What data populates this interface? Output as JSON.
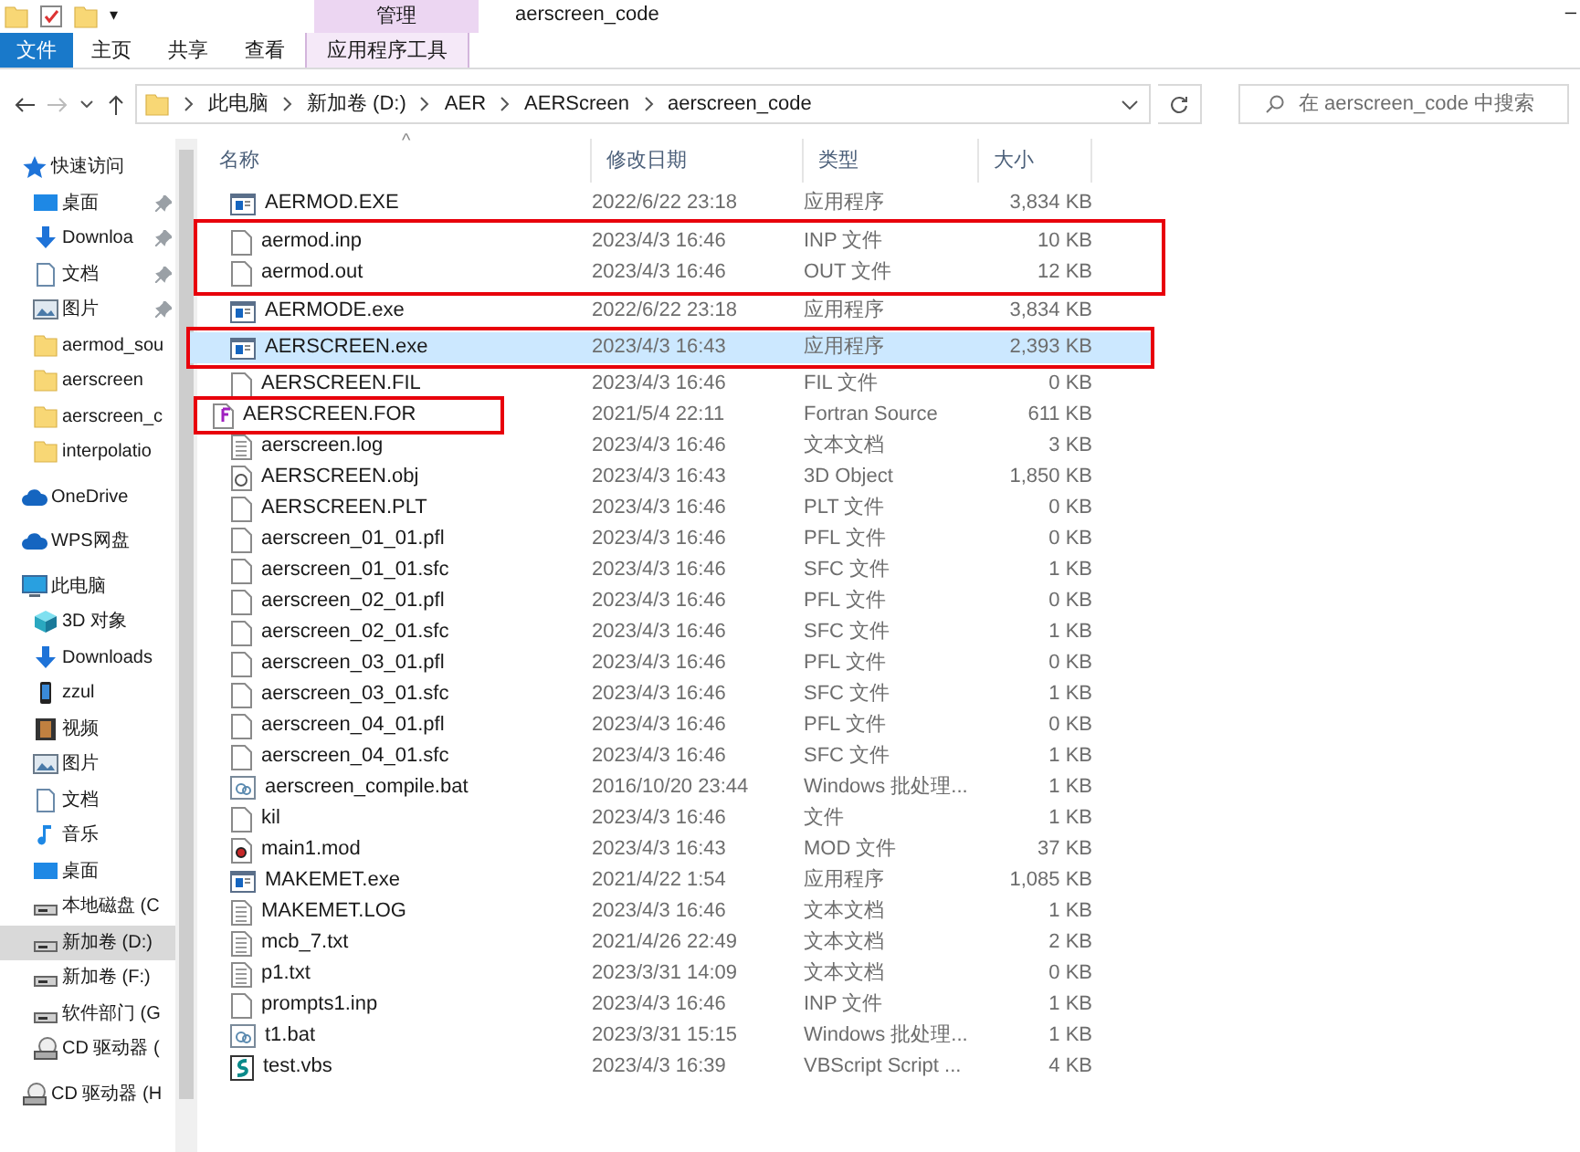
{
  "title_bar": {
    "context_tab": "管理",
    "title": "aerscreen_code",
    "quick_access_caret": "▾",
    "minimize": "–"
  },
  "ribbon_tabs": [
    {
      "label": "文件",
      "kind": "file"
    },
    {
      "label": "主页",
      "kind": "tab"
    },
    {
      "label": "共享",
      "kind": "tab"
    },
    {
      "label": "查看",
      "kind": "tab"
    },
    {
      "label": "应用程序工具",
      "kind": "context"
    }
  ],
  "address_bar": {
    "path": [
      "此电脑",
      "新加卷 (D:)",
      "AER",
      "AERScreen",
      "aerscreen_code"
    ]
  },
  "search": {
    "placeholder": "在 aerscreen_code 中搜索"
  },
  "sidebar": [
    {
      "label": "快速访问",
      "kind": "star",
      "selected": false,
      "children": [
        {
          "label": "桌面",
          "kind": "desktop",
          "pinned": true,
          "selected": false
        },
        {
          "label": "Downloa",
          "kind": "download",
          "pinned": true,
          "selected": false
        },
        {
          "label": "文档",
          "kind": "doc",
          "pinned": true,
          "selected": false
        },
        {
          "label": "图片",
          "kind": "pic",
          "pinned": true,
          "selected": false
        },
        {
          "label": "aermod_sou",
          "kind": "folder",
          "pinned": false,
          "selected": false
        },
        {
          "label": "aerscreen",
          "kind": "folder",
          "pinned": false,
          "selected": false
        },
        {
          "label": "aerscreen_c",
          "kind": "folder",
          "pinned": false,
          "selected": false
        },
        {
          "label": "interpolatio",
          "kind": "folder",
          "pinned": false,
          "selected": false
        }
      ]
    },
    {
      "label": "OneDrive",
      "kind": "cloud",
      "selected": false
    },
    {
      "label": "WPS网盘",
      "kind": "cloud",
      "selected": false
    },
    {
      "label": "此电脑",
      "kind": "pc",
      "selected": false,
      "children": [
        {
          "label": "3D 对象",
          "kind": "cube",
          "selected": false
        },
        {
          "label": "Downloads",
          "kind": "download",
          "selected": false
        },
        {
          "label": "zzul",
          "kind": "phone",
          "selected": false
        },
        {
          "label": "视频",
          "kind": "video",
          "selected": false
        },
        {
          "label": "图片",
          "kind": "pic",
          "selected": false
        },
        {
          "label": "文档",
          "kind": "doc",
          "selected": false
        },
        {
          "label": "音乐",
          "kind": "music",
          "selected": false
        },
        {
          "label": "桌面",
          "kind": "desktop",
          "selected": false
        },
        {
          "label": "本地磁盘 (C",
          "kind": "drive",
          "selected": false
        },
        {
          "label": "新加卷 (D:)",
          "kind": "drive",
          "selected": true
        },
        {
          "label": "新加卷 (F:)",
          "kind": "drive",
          "selected": false
        },
        {
          "label": "软件部门 (G",
          "kind": "drive",
          "selected": false
        },
        {
          "label": "CD 驱动器 (",
          "kind": "cd",
          "selected": false
        }
      ]
    },
    {
      "label": "CD 驱动器 (H",
      "kind": "cd",
      "selected": false
    }
  ],
  "table": {
    "columns": [
      "名称",
      "修改日期",
      "类型",
      "大小"
    ],
    "sort_caret": "^",
    "rows": [
      {
        "name": "AERMOD.EXE",
        "date": "2022/6/22 23:18",
        "type": "应用程序",
        "size": "3,834 KB",
        "kind": "exe",
        "selected": false
      },
      {
        "name": "aermod.inp",
        "date": "2023/4/3 16:46",
        "type": "INP 文件",
        "size": "10 KB",
        "kind": "blank",
        "selected": false,
        "outlined": true
      },
      {
        "name": "aermod.out",
        "date": "2023/4/3 16:46",
        "type": "OUT 文件",
        "size": "12 KB",
        "kind": "blank",
        "selected": false,
        "outlined": true
      },
      {
        "name": "AERMODE.exe",
        "date": "2022/6/22 23:18",
        "type": "应用程序",
        "size": "3,834 KB",
        "kind": "exe",
        "selected": false
      },
      {
        "name": "AERSCREEN.exe",
        "date": "2023/4/3 16:43",
        "type": "应用程序",
        "size": "2,393 KB",
        "kind": "exe",
        "selected": true,
        "outlined": true
      },
      {
        "name": "AERSCREEN.FIL",
        "date": "2023/4/3 16:46",
        "type": "FIL 文件",
        "size": "0 KB",
        "kind": "blank",
        "selected": false
      },
      {
        "name": "AERSCREEN.FOR",
        "date": "2021/5/4 22:11",
        "type": "Fortran Source",
        "size": "611 KB",
        "kind": "fortran",
        "selected": false,
        "name_outlined": true
      },
      {
        "name": "aerscreen.log",
        "date": "2023/4/3 16:46",
        "type": "文本文档",
        "size": "3 KB",
        "kind": "text",
        "selected": false
      },
      {
        "name": "AERSCREEN.obj",
        "date": "2023/4/3 16:43",
        "type": "3D Object",
        "size": "1,850 KB",
        "kind": "obj",
        "selected": false
      },
      {
        "name": "AERSCREEN.PLT",
        "date": "2023/4/3 16:46",
        "type": "PLT 文件",
        "size": "0 KB",
        "kind": "blank",
        "selected": false
      },
      {
        "name": "aerscreen_01_01.pfl",
        "date": "2023/4/3 16:46",
        "type": "PFL 文件",
        "size": "0 KB",
        "kind": "blank",
        "selected": false
      },
      {
        "name": "aerscreen_01_01.sfc",
        "date": "2023/4/3 16:46",
        "type": "SFC 文件",
        "size": "1 KB",
        "kind": "blank",
        "selected": false
      },
      {
        "name": "aerscreen_02_01.pfl",
        "date": "2023/4/3 16:46",
        "type": "PFL 文件",
        "size": "0 KB",
        "kind": "blank",
        "selected": false
      },
      {
        "name": "aerscreen_02_01.sfc",
        "date": "2023/4/3 16:46",
        "type": "SFC 文件",
        "size": "1 KB",
        "kind": "blank",
        "selected": false
      },
      {
        "name": "aerscreen_03_01.pfl",
        "date": "2023/4/3 16:46",
        "type": "PFL 文件",
        "size": "0 KB",
        "kind": "blank",
        "selected": false
      },
      {
        "name": "aerscreen_03_01.sfc",
        "date": "2023/4/3 16:46",
        "type": "SFC 文件",
        "size": "1 KB",
        "kind": "blank",
        "selected": false
      },
      {
        "name": "aerscreen_04_01.pfl",
        "date": "2023/4/3 16:46",
        "type": "PFL 文件",
        "size": "0 KB",
        "kind": "blank",
        "selected": false
      },
      {
        "name": "aerscreen_04_01.sfc",
        "date": "2023/4/3 16:46",
        "type": "SFC 文件",
        "size": "1 KB",
        "kind": "blank",
        "selected": false
      },
      {
        "name": "aerscreen_compile.bat",
        "date": "2016/10/20 23:44",
        "type": "Windows 批处理...",
        "size": "1 KB",
        "kind": "bat",
        "selected": false
      },
      {
        "name": "kil",
        "date": "2023/4/3 16:46",
        "type": "文件",
        "size": "1 KB",
        "kind": "blank",
        "selected": false
      },
      {
        "name": "main1.mod",
        "date": "2023/4/3 16:43",
        "type": "MOD 文件",
        "size": "37 KB",
        "kind": "mod",
        "selected": false
      },
      {
        "name": "MAKEMET.exe",
        "date": "2021/4/22 1:54",
        "type": "应用程序",
        "size": "1,085 KB",
        "kind": "exe",
        "selected": false
      },
      {
        "name": "MAKEMET.LOG",
        "date": "2023/4/3 16:46",
        "type": "文本文档",
        "size": "1 KB",
        "kind": "text",
        "selected": false
      },
      {
        "name": "mcb_7.txt",
        "date": "2021/4/26 22:49",
        "type": "文本文档",
        "size": "2 KB",
        "kind": "text",
        "selected": false
      },
      {
        "name": "p1.txt",
        "date": "2023/3/31 14:09",
        "type": "文本文档",
        "size": "0 KB",
        "kind": "text",
        "selected": false
      },
      {
        "name": "prompts1.inp",
        "date": "2023/4/3 16:46",
        "type": "INP 文件",
        "size": "1 KB",
        "kind": "blank",
        "selected": false
      },
      {
        "name": "t1.bat",
        "date": "2023/3/31 15:15",
        "type": "Windows 批处理...",
        "size": "1 KB",
        "kind": "bat",
        "selected": false
      },
      {
        "name": "test.vbs",
        "date": "2023/4/3 16:39",
        "type": "VBScript Script ...",
        "size": "4 KB",
        "kind": "vbs",
        "selected": false
      }
    ]
  }
}
